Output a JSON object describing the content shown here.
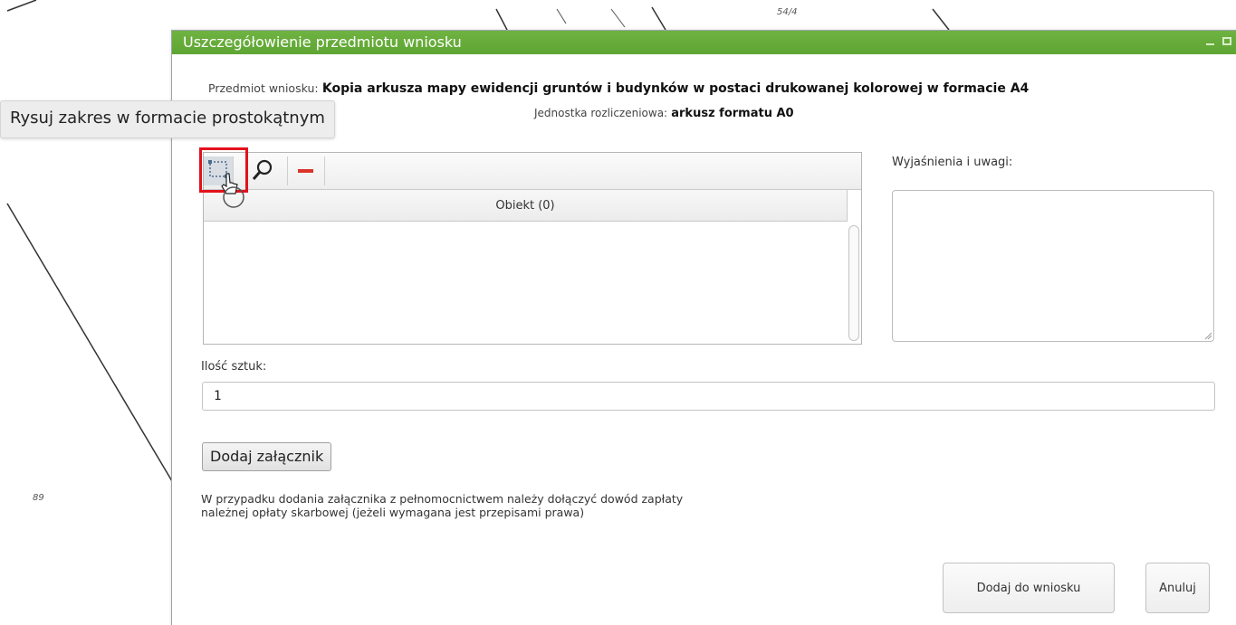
{
  "map": {
    "labels": [
      "54/4",
      "89"
    ]
  },
  "dialog": {
    "title": "Uszczegółowienie przedmiotu wniosku",
    "subject_label": "Przedmiot wniosku:",
    "subject_value": "Kopia arkusza mapy ewidencji gruntów i budynków w postaci drukowanej kolorowej w formacie A4",
    "unit_label": "Jednostka rozliczeniowa:",
    "unit_value": "arkusz formatu A0",
    "grid": {
      "toolbar": {
        "draw_rect_icon": "draw-rectangle-icon",
        "zoom_icon": "magnifier-icon",
        "remove_icon": "minus-icon"
      },
      "column_header": "Obiekt (0)"
    },
    "remarks_label": "Wyjaśnienia i uwagi:",
    "remarks_value": "",
    "quantity_label": "Ilość sztuk:",
    "quantity_value": "1",
    "attach_button": "Dodaj załącznik",
    "attach_note_line1": "W przypadku dodania załącznika z pełnomocnictwem należy dołączyć dowód zapłaty",
    "attach_note_line2": "należnej opłaty skarbowej (jeżeli wymagana jest przepisami prawa)",
    "add_button": "Dodaj do wniosku",
    "cancel_button": "Anuluj"
  },
  "tooltip": {
    "text": "Rysuj zakres w formacie prostokątnym"
  },
  "colors": {
    "titlebar": "#5ea533",
    "highlight": "#e3101c",
    "remove_icon": "#d9342b"
  }
}
